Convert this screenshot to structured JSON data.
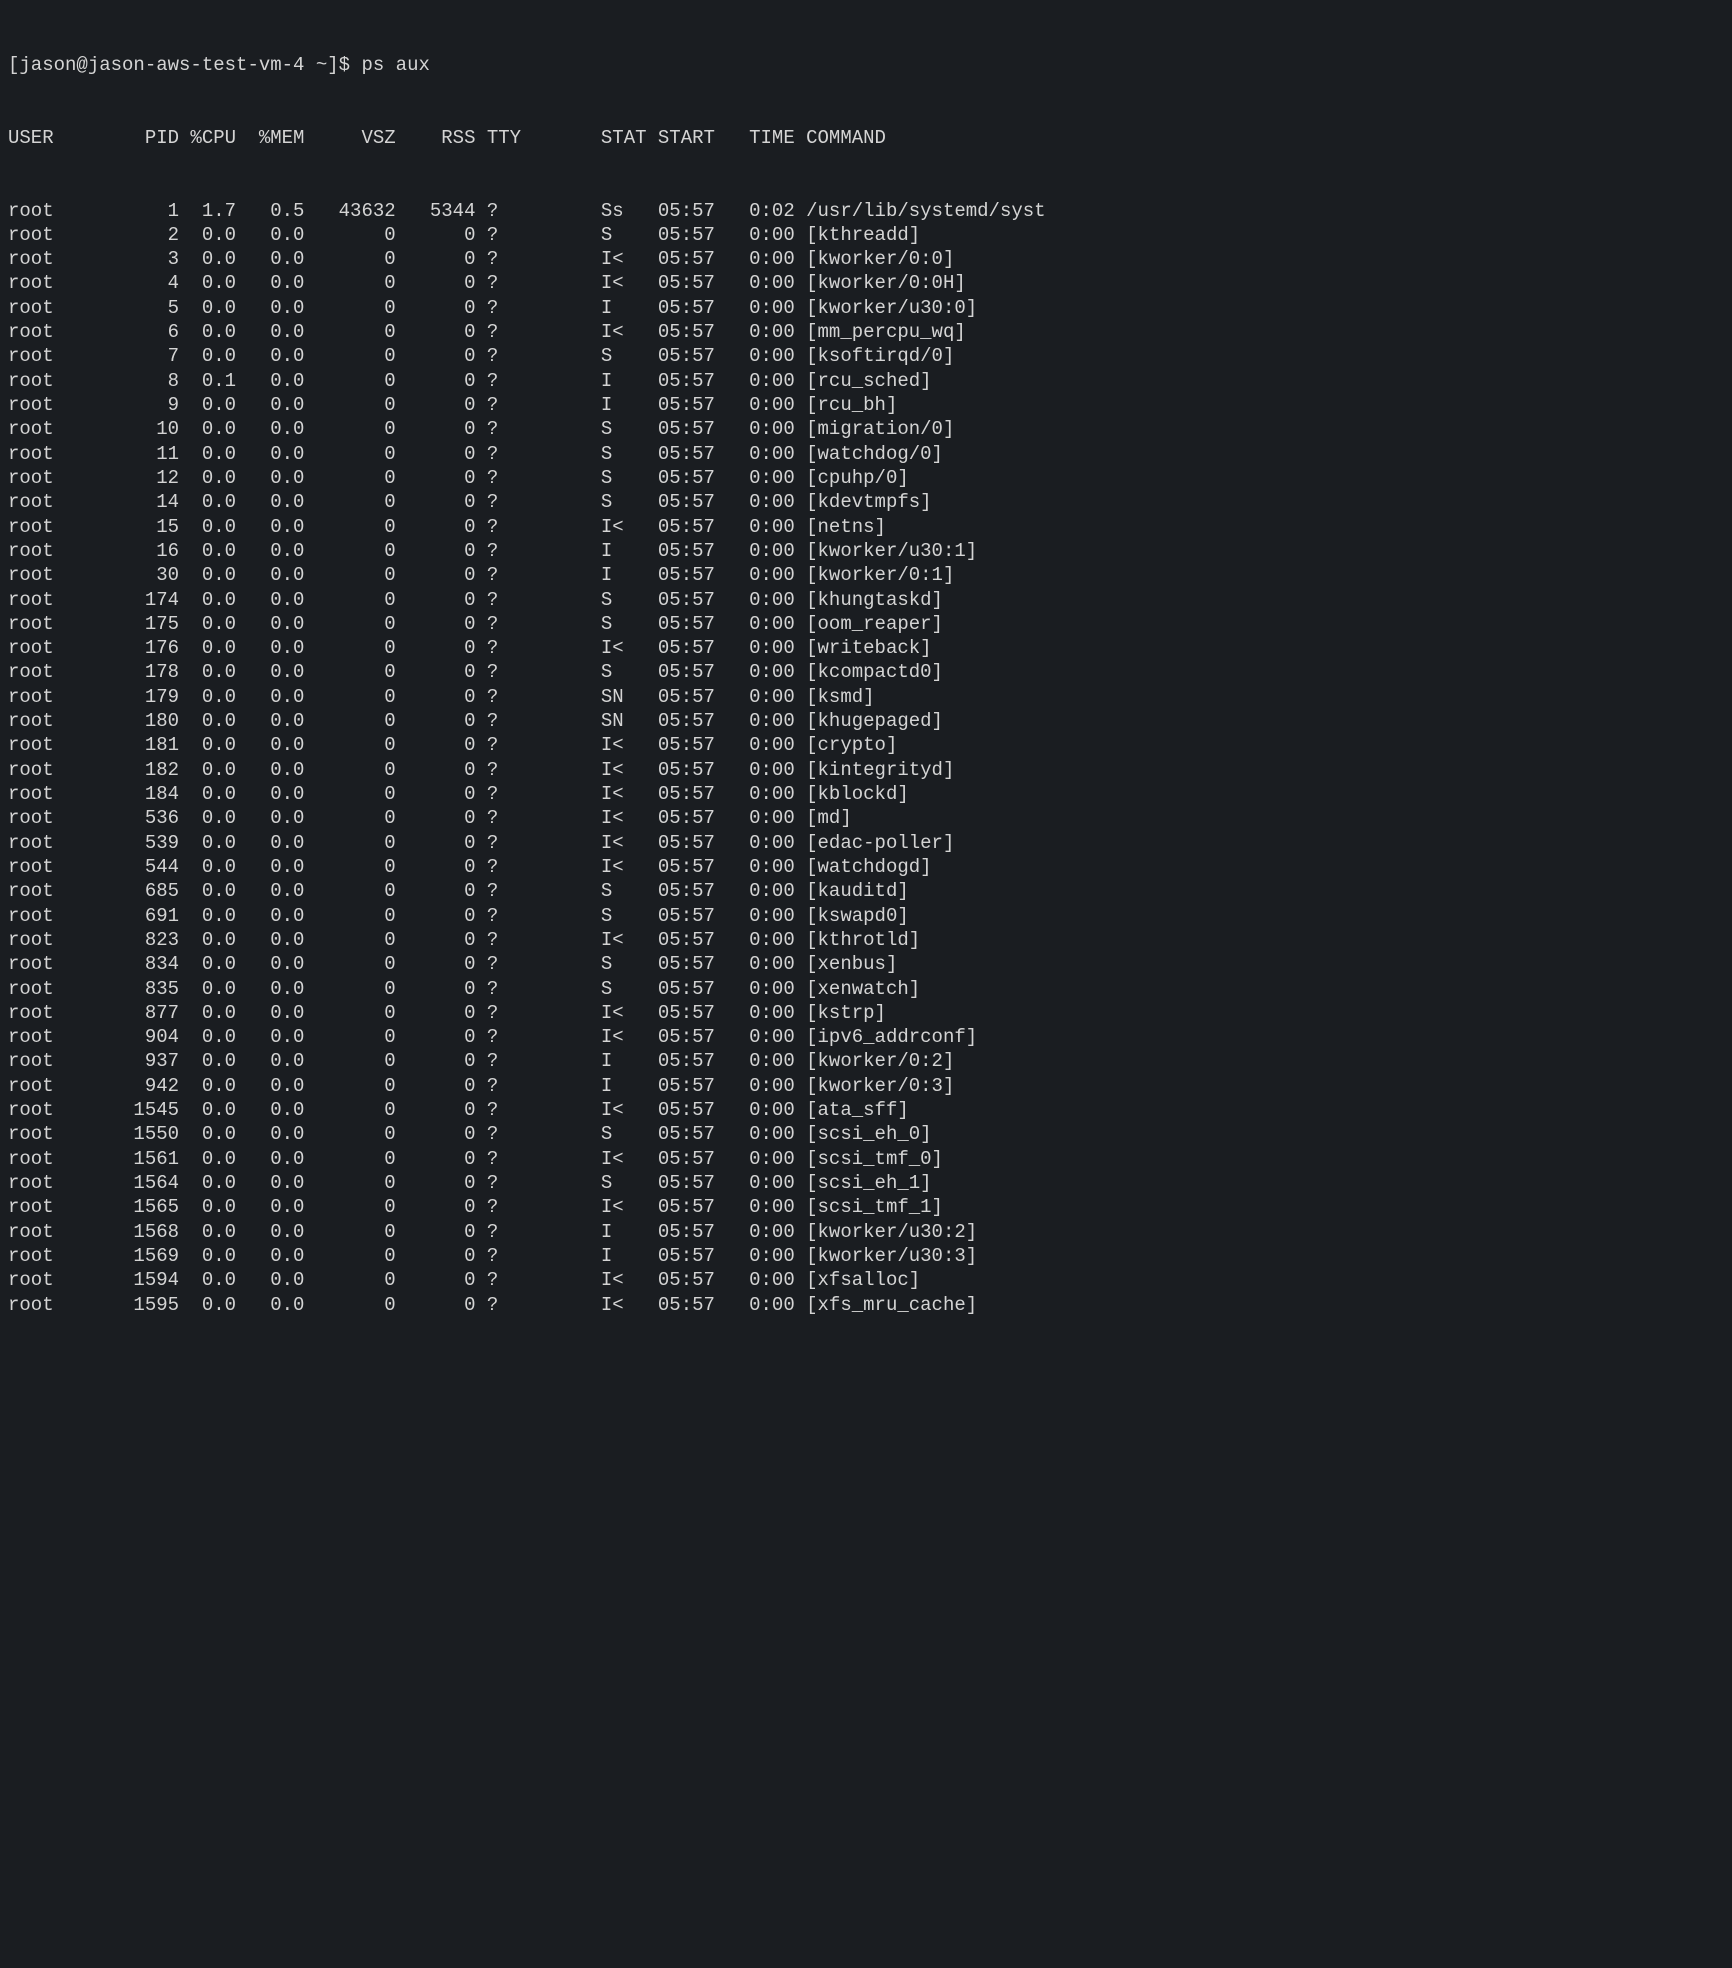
{
  "prompt": {
    "text": "[jason@jason-aws-test-vm-4 ~]$ ps aux"
  },
  "headers": {
    "USER": "USER",
    "PID": "PID",
    "CPU": "%CPU",
    "MEM": "%MEM",
    "VSZ": "VSZ",
    "RSS": "RSS",
    "TTY": "TTY",
    "STAT": "STAT",
    "START": "START",
    "TIME": "TIME",
    "COMMAND": "COMMAND"
  },
  "rows": [
    {
      "user": "root",
      "pid": "1",
      "cpu": "1.7",
      "mem": "0.5",
      "vsz": "43632",
      "rss": "5344",
      "tty": "?",
      "stat": "Ss",
      "start": "05:57",
      "time": "0:02",
      "cmd": "/usr/lib/systemd/syst"
    },
    {
      "user": "root",
      "pid": "2",
      "cpu": "0.0",
      "mem": "0.0",
      "vsz": "0",
      "rss": "0",
      "tty": "?",
      "stat": "S",
      "start": "05:57",
      "time": "0:00",
      "cmd": "[kthreadd]"
    },
    {
      "user": "root",
      "pid": "3",
      "cpu": "0.0",
      "mem": "0.0",
      "vsz": "0",
      "rss": "0",
      "tty": "?",
      "stat": "I<",
      "start": "05:57",
      "time": "0:00",
      "cmd": "[kworker/0:0]"
    },
    {
      "user": "root",
      "pid": "4",
      "cpu": "0.0",
      "mem": "0.0",
      "vsz": "0",
      "rss": "0",
      "tty": "?",
      "stat": "I<",
      "start": "05:57",
      "time": "0:00",
      "cmd": "[kworker/0:0H]"
    },
    {
      "user": "root",
      "pid": "5",
      "cpu": "0.0",
      "mem": "0.0",
      "vsz": "0",
      "rss": "0",
      "tty": "?",
      "stat": "I",
      "start": "05:57",
      "time": "0:00",
      "cmd": "[kworker/u30:0]"
    },
    {
      "user": "root",
      "pid": "6",
      "cpu": "0.0",
      "mem": "0.0",
      "vsz": "0",
      "rss": "0",
      "tty": "?",
      "stat": "I<",
      "start": "05:57",
      "time": "0:00",
      "cmd": "[mm_percpu_wq]"
    },
    {
      "user": "root",
      "pid": "7",
      "cpu": "0.0",
      "mem": "0.0",
      "vsz": "0",
      "rss": "0",
      "tty": "?",
      "stat": "S",
      "start": "05:57",
      "time": "0:00",
      "cmd": "[ksoftirqd/0]"
    },
    {
      "user": "root",
      "pid": "8",
      "cpu": "0.1",
      "mem": "0.0",
      "vsz": "0",
      "rss": "0",
      "tty": "?",
      "stat": "I",
      "start": "05:57",
      "time": "0:00",
      "cmd": "[rcu_sched]"
    },
    {
      "user": "root",
      "pid": "9",
      "cpu": "0.0",
      "mem": "0.0",
      "vsz": "0",
      "rss": "0",
      "tty": "?",
      "stat": "I",
      "start": "05:57",
      "time": "0:00",
      "cmd": "[rcu_bh]"
    },
    {
      "user": "root",
      "pid": "10",
      "cpu": "0.0",
      "mem": "0.0",
      "vsz": "0",
      "rss": "0",
      "tty": "?",
      "stat": "S",
      "start": "05:57",
      "time": "0:00",
      "cmd": "[migration/0]"
    },
    {
      "user": "root",
      "pid": "11",
      "cpu": "0.0",
      "mem": "0.0",
      "vsz": "0",
      "rss": "0",
      "tty": "?",
      "stat": "S",
      "start": "05:57",
      "time": "0:00",
      "cmd": "[watchdog/0]"
    },
    {
      "user": "root",
      "pid": "12",
      "cpu": "0.0",
      "mem": "0.0",
      "vsz": "0",
      "rss": "0",
      "tty": "?",
      "stat": "S",
      "start": "05:57",
      "time": "0:00",
      "cmd": "[cpuhp/0]"
    },
    {
      "user": "root",
      "pid": "14",
      "cpu": "0.0",
      "mem": "0.0",
      "vsz": "0",
      "rss": "0",
      "tty": "?",
      "stat": "S",
      "start": "05:57",
      "time": "0:00",
      "cmd": "[kdevtmpfs]"
    },
    {
      "user": "root",
      "pid": "15",
      "cpu": "0.0",
      "mem": "0.0",
      "vsz": "0",
      "rss": "0",
      "tty": "?",
      "stat": "I<",
      "start": "05:57",
      "time": "0:00",
      "cmd": "[netns]"
    },
    {
      "user": "root",
      "pid": "16",
      "cpu": "0.0",
      "mem": "0.0",
      "vsz": "0",
      "rss": "0",
      "tty": "?",
      "stat": "I",
      "start": "05:57",
      "time": "0:00",
      "cmd": "[kworker/u30:1]"
    },
    {
      "user": "root",
      "pid": "30",
      "cpu": "0.0",
      "mem": "0.0",
      "vsz": "0",
      "rss": "0",
      "tty": "?",
      "stat": "I",
      "start": "05:57",
      "time": "0:00",
      "cmd": "[kworker/0:1]"
    },
    {
      "user": "root",
      "pid": "174",
      "cpu": "0.0",
      "mem": "0.0",
      "vsz": "0",
      "rss": "0",
      "tty": "?",
      "stat": "S",
      "start": "05:57",
      "time": "0:00",
      "cmd": "[khungtaskd]"
    },
    {
      "user": "root",
      "pid": "175",
      "cpu": "0.0",
      "mem": "0.0",
      "vsz": "0",
      "rss": "0",
      "tty": "?",
      "stat": "S",
      "start": "05:57",
      "time": "0:00",
      "cmd": "[oom_reaper]"
    },
    {
      "user": "root",
      "pid": "176",
      "cpu": "0.0",
      "mem": "0.0",
      "vsz": "0",
      "rss": "0",
      "tty": "?",
      "stat": "I<",
      "start": "05:57",
      "time": "0:00",
      "cmd": "[writeback]"
    },
    {
      "user": "root",
      "pid": "178",
      "cpu": "0.0",
      "mem": "0.0",
      "vsz": "0",
      "rss": "0",
      "tty": "?",
      "stat": "S",
      "start": "05:57",
      "time": "0:00",
      "cmd": "[kcompactd0]"
    },
    {
      "user": "root",
      "pid": "179",
      "cpu": "0.0",
      "mem": "0.0",
      "vsz": "0",
      "rss": "0",
      "tty": "?",
      "stat": "SN",
      "start": "05:57",
      "time": "0:00",
      "cmd": "[ksmd]"
    },
    {
      "user": "root",
      "pid": "180",
      "cpu": "0.0",
      "mem": "0.0",
      "vsz": "0",
      "rss": "0",
      "tty": "?",
      "stat": "SN",
      "start": "05:57",
      "time": "0:00",
      "cmd": "[khugepaged]"
    },
    {
      "user": "root",
      "pid": "181",
      "cpu": "0.0",
      "mem": "0.0",
      "vsz": "0",
      "rss": "0",
      "tty": "?",
      "stat": "I<",
      "start": "05:57",
      "time": "0:00",
      "cmd": "[crypto]"
    },
    {
      "user": "root",
      "pid": "182",
      "cpu": "0.0",
      "mem": "0.0",
      "vsz": "0",
      "rss": "0",
      "tty": "?",
      "stat": "I<",
      "start": "05:57",
      "time": "0:00",
      "cmd": "[kintegrityd]"
    },
    {
      "user": "root",
      "pid": "184",
      "cpu": "0.0",
      "mem": "0.0",
      "vsz": "0",
      "rss": "0",
      "tty": "?",
      "stat": "I<",
      "start": "05:57",
      "time": "0:00",
      "cmd": "[kblockd]"
    },
    {
      "user": "root",
      "pid": "536",
      "cpu": "0.0",
      "mem": "0.0",
      "vsz": "0",
      "rss": "0",
      "tty": "?",
      "stat": "I<",
      "start": "05:57",
      "time": "0:00",
      "cmd": "[md]"
    },
    {
      "user": "root",
      "pid": "539",
      "cpu": "0.0",
      "mem": "0.0",
      "vsz": "0",
      "rss": "0",
      "tty": "?",
      "stat": "I<",
      "start": "05:57",
      "time": "0:00",
      "cmd": "[edac-poller]"
    },
    {
      "user": "root",
      "pid": "544",
      "cpu": "0.0",
      "mem": "0.0",
      "vsz": "0",
      "rss": "0",
      "tty": "?",
      "stat": "I<",
      "start": "05:57",
      "time": "0:00",
      "cmd": "[watchdogd]"
    },
    {
      "user": "root",
      "pid": "685",
      "cpu": "0.0",
      "mem": "0.0",
      "vsz": "0",
      "rss": "0",
      "tty": "?",
      "stat": "S",
      "start": "05:57",
      "time": "0:00",
      "cmd": "[kauditd]"
    },
    {
      "user": "root",
      "pid": "691",
      "cpu": "0.0",
      "mem": "0.0",
      "vsz": "0",
      "rss": "0",
      "tty": "?",
      "stat": "S",
      "start": "05:57",
      "time": "0:00",
      "cmd": "[kswapd0]"
    },
    {
      "user": "root",
      "pid": "823",
      "cpu": "0.0",
      "mem": "0.0",
      "vsz": "0",
      "rss": "0",
      "tty": "?",
      "stat": "I<",
      "start": "05:57",
      "time": "0:00",
      "cmd": "[kthrotld]"
    },
    {
      "user": "root",
      "pid": "834",
      "cpu": "0.0",
      "mem": "0.0",
      "vsz": "0",
      "rss": "0",
      "tty": "?",
      "stat": "S",
      "start": "05:57",
      "time": "0:00",
      "cmd": "[xenbus]"
    },
    {
      "user": "root",
      "pid": "835",
      "cpu": "0.0",
      "mem": "0.0",
      "vsz": "0",
      "rss": "0",
      "tty": "?",
      "stat": "S",
      "start": "05:57",
      "time": "0:00",
      "cmd": "[xenwatch]"
    },
    {
      "user": "root",
      "pid": "877",
      "cpu": "0.0",
      "mem": "0.0",
      "vsz": "0",
      "rss": "0",
      "tty": "?",
      "stat": "I<",
      "start": "05:57",
      "time": "0:00",
      "cmd": "[kstrp]"
    },
    {
      "user": "root",
      "pid": "904",
      "cpu": "0.0",
      "mem": "0.0",
      "vsz": "0",
      "rss": "0",
      "tty": "?",
      "stat": "I<",
      "start": "05:57",
      "time": "0:00",
      "cmd": "[ipv6_addrconf]"
    },
    {
      "user": "root",
      "pid": "937",
      "cpu": "0.0",
      "mem": "0.0",
      "vsz": "0",
      "rss": "0",
      "tty": "?",
      "stat": "I",
      "start": "05:57",
      "time": "0:00",
      "cmd": "[kworker/0:2]"
    },
    {
      "user": "root",
      "pid": "942",
      "cpu": "0.0",
      "mem": "0.0",
      "vsz": "0",
      "rss": "0",
      "tty": "?",
      "stat": "I",
      "start": "05:57",
      "time": "0:00",
      "cmd": "[kworker/0:3]"
    },
    {
      "user": "root",
      "pid": "1545",
      "cpu": "0.0",
      "mem": "0.0",
      "vsz": "0",
      "rss": "0",
      "tty": "?",
      "stat": "I<",
      "start": "05:57",
      "time": "0:00",
      "cmd": "[ata_sff]"
    },
    {
      "user": "root",
      "pid": "1550",
      "cpu": "0.0",
      "mem": "0.0",
      "vsz": "0",
      "rss": "0",
      "tty": "?",
      "stat": "S",
      "start": "05:57",
      "time": "0:00",
      "cmd": "[scsi_eh_0]"
    },
    {
      "user": "root",
      "pid": "1561",
      "cpu": "0.0",
      "mem": "0.0",
      "vsz": "0",
      "rss": "0",
      "tty": "?",
      "stat": "I<",
      "start": "05:57",
      "time": "0:00",
      "cmd": "[scsi_tmf_0]"
    },
    {
      "user": "root",
      "pid": "1564",
      "cpu": "0.0",
      "mem": "0.0",
      "vsz": "0",
      "rss": "0",
      "tty": "?",
      "stat": "S",
      "start": "05:57",
      "time": "0:00",
      "cmd": "[scsi_eh_1]"
    },
    {
      "user": "root",
      "pid": "1565",
      "cpu": "0.0",
      "mem": "0.0",
      "vsz": "0",
      "rss": "0",
      "tty": "?",
      "stat": "I<",
      "start": "05:57",
      "time": "0:00",
      "cmd": "[scsi_tmf_1]"
    },
    {
      "user": "root",
      "pid": "1568",
      "cpu": "0.0",
      "mem": "0.0",
      "vsz": "0",
      "rss": "0",
      "tty": "?",
      "stat": "I",
      "start": "05:57",
      "time": "0:00",
      "cmd": "[kworker/u30:2]"
    },
    {
      "user": "root",
      "pid": "1569",
      "cpu": "0.0",
      "mem": "0.0",
      "vsz": "0",
      "rss": "0",
      "tty": "?",
      "stat": "I",
      "start": "05:57",
      "time": "0:00",
      "cmd": "[kworker/u30:3]"
    },
    {
      "user": "root",
      "pid": "1594",
      "cpu": "0.0",
      "mem": "0.0",
      "vsz": "0",
      "rss": "0",
      "tty": "?",
      "stat": "I<",
      "start": "05:57",
      "time": "0:00",
      "cmd": "[xfsalloc]"
    },
    {
      "user": "root",
      "pid": "1595",
      "cpu": "0.0",
      "mem": "0.0",
      "vsz": "0",
      "rss": "0",
      "tty": "?",
      "stat": "I<",
      "start": "05:57",
      "time": "0:00",
      "cmd": "[xfs_mru_cache]"
    }
  ]
}
